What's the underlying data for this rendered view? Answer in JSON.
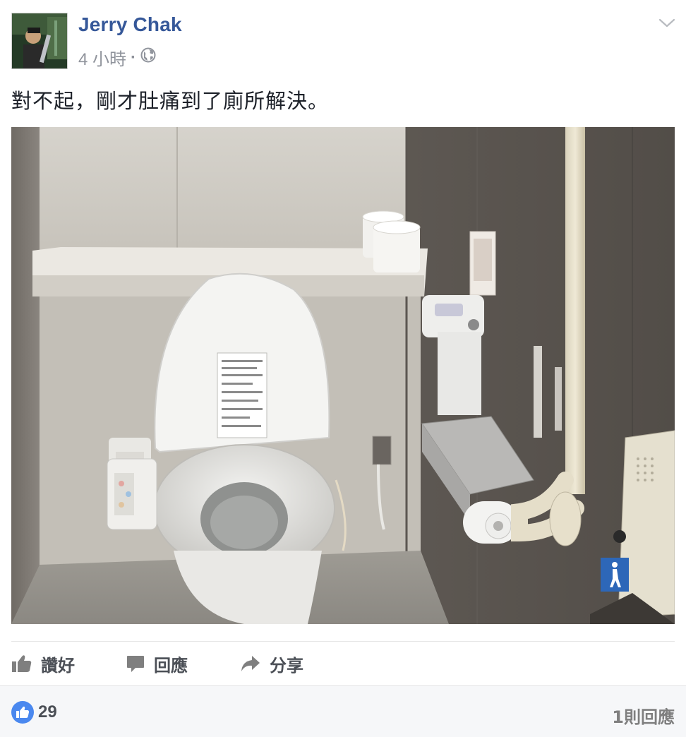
{
  "post": {
    "author": "Jerry Chak",
    "timestamp": "4 小時",
    "separator": "·",
    "privacy_icon": "globe-icon",
    "text": "對不起，剛才肚痛到了廁所解決。",
    "menu_icon": "chevron-down-icon"
  },
  "actions": {
    "like_label": "讚好",
    "comment_label": "回應",
    "share_label": "分享"
  },
  "footer": {
    "like_count": "29",
    "comment_count": "1則回應"
  },
  "colors": {
    "author": "#365899",
    "meta": "#90949c",
    "action": "#4b4f56",
    "like_bubble": "#4a88ef"
  }
}
